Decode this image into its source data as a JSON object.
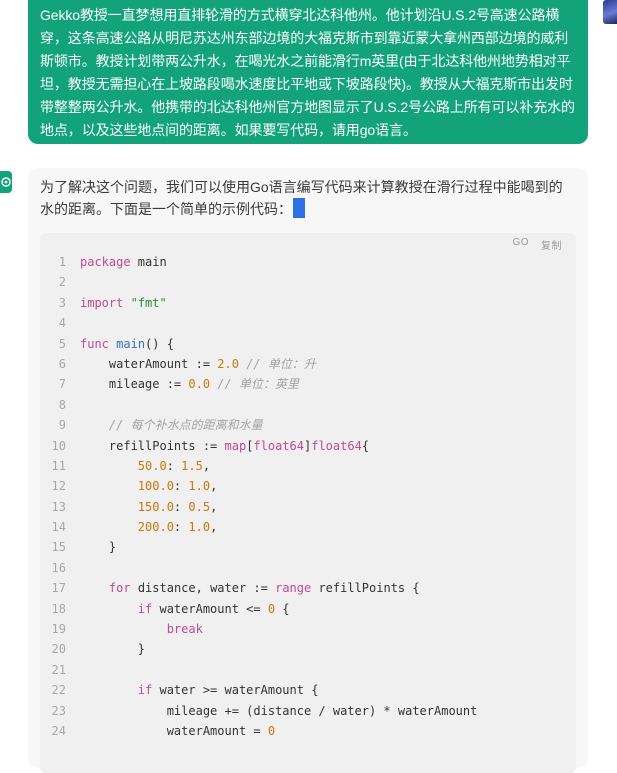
{
  "user_message": {
    "text": "Gekko教授一直梦想用直排轮滑的方式横穿北达科他州。他计划沿U.S.2号高速公路横穿，这条高速公路从明尼苏达州东部边境的大福克斯市到靠近蒙大拿州西部边境的威利斯顿市。教授计划带两公升水，在喝光水之前能滑行m英里(由于北达科他州地势相对平坦，教授无需担心在上坡路段喝水速度比平地或下坡路段快)。教授从大福克斯市出发时带整整两公升水。他携带的北达科他州官方地图显示了U.S.2号公路上所有可以补充水的地点，以及这些地点间的距离。如果要写代码，请用go语言。"
  },
  "assistant_message": {
    "intro": "为了解决这个问题，我们可以使用Go语言编写代码来计算教授在滑行过程中能喝到的水的距离。下面是一个简单的示例代码："
  },
  "code_block": {
    "language_label": "GO",
    "copy_label": "复制",
    "lines": [
      {
        "n": "1",
        "tokens": [
          [
            "kw",
            "package"
          ],
          [
            "tx",
            " main"
          ]
        ]
      },
      {
        "n": "2",
        "tokens": []
      },
      {
        "n": "3",
        "tokens": [
          [
            "kw",
            "import"
          ],
          [
            "tx",
            " "
          ],
          [
            "str",
            "\"fmt\""
          ]
        ]
      },
      {
        "n": "4",
        "tokens": []
      },
      {
        "n": "5",
        "tokens": [
          [
            "kw",
            "func"
          ],
          [
            "tx",
            " "
          ],
          [
            "fn",
            "main"
          ],
          [
            "tx",
            "() {"
          ]
        ]
      },
      {
        "n": "6",
        "tokens": [
          [
            "tx",
            "    waterAmount := "
          ],
          [
            "num",
            "2.0"
          ],
          [
            "tx",
            " "
          ],
          [
            "cm",
            "// 单位：升"
          ]
        ]
      },
      {
        "n": "7",
        "tokens": [
          [
            "tx",
            "    mileage := "
          ],
          [
            "num",
            "0.0"
          ],
          [
            "tx",
            " "
          ],
          [
            "cm",
            "// 单位：英里"
          ]
        ]
      },
      {
        "n": "8",
        "tokens": []
      },
      {
        "n": "9",
        "tokens": [
          [
            "tx",
            "    "
          ],
          [
            "cm",
            "// 每个补水点的距离和水量"
          ]
        ]
      },
      {
        "n": "10",
        "tokens": [
          [
            "tx",
            "    refillPoints := "
          ],
          [
            "kw",
            "map"
          ],
          [
            "tx",
            "["
          ],
          [
            "kw",
            "float64"
          ],
          [
            "tx",
            "]"
          ],
          [
            "kw",
            "float64"
          ],
          [
            "tx",
            "{"
          ]
        ]
      },
      {
        "n": "11",
        "tokens": [
          [
            "tx",
            "        "
          ],
          [
            "num",
            "50.0"
          ],
          [
            "tx",
            ": "
          ],
          [
            "num",
            "1.5"
          ],
          [
            "tx",
            ","
          ]
        ]
      },
      {
        "n": "12",
        "tokens": [
          [
            "tx",
            "        "
          ],
          [
            "num",
            "100.0"
          ],
          [
            "tx",
            ": "
          ],
          [
            "num",
            "1.0"
          ],
          [
            "tx",
            ","
          ]
        ]
      },
      {
        "n": "13",
        "tokens": [
          [
            "tx",
            "        "
          ],
          [
            "num",
            "150.0"
          ],
          [
            "tx",
            ": "
          ],
          [
            "num",
            "0.5"
          ],
          [
            "tx",
            ","
          ]
        ]
      },
      {
        "n": "14",
        "tokens": [
          [
            "tx",
            "        "
          ],
          [
            "num",
            "200.0"
          ],
          [
            "tx",
            ": "
          ],
          [
            "num",
            "1.0"
          ],
          [
            "tx",
            ","
          ]
        ]
      },
      {
        "n": "15",
        "tokens": [
          [
            "tx",
            "    }"
          ]
        ]
      },
      {
        "n": "16",
        "tokens": []
      },
      {
        "n": "17",
        "tokens": [
          [
            "tx",
            "    "
          ],
          [
            "kw",
            "for"
          ],
          [
            "tx",
            " distance, water := "
          ],
          [
            "kw",
            "range"
          ],
          [
            "tx",
            " refillPoints {"
          ]
        ]
      },
      {
        "n": "18",
        "tokens": [
          [
            "tx",
            "        "
          ],
          [
            "kw",
            "if"
          ],
          [
            "tx",
            " waterAmount <= "
          ],
          [
            "num",
            "0"
          ],
          [
            "tx",
            " {"
          ]
        ]
      },
      {
        "n": "19",
        "tokens": [
          [
            "tx",
            "            "
          ],
          [
            "kw",
            "break"
          ]
        ]
      },
      {
        "n": "20",
        "tokens": [
          [
            "tx",
            "        }"
          ]
        ]
      },
      {
        "n": "21",
        "tokens": []
      },
      {
        "n": "22",
        "tokens": [
          [
            "tx",
            "        "
          ],
          [
            "kw",
            "if"
          ],
          [
            "tx",
            " water >= waterAmount {"
          ]
        ]
      },
      {
        "n": "23",
        "tokens": [
          [
            "tx",
            "            mileage += (distance / water) * waterAmount"
          ]
        ]
      },
      {
        "n": "24",
        "tokens": [
          [
            "tx",
            "            waterAmount = "
          ],
          [
            "num",
            "0"
          ]
        ]
      }
    ]
  }
}
